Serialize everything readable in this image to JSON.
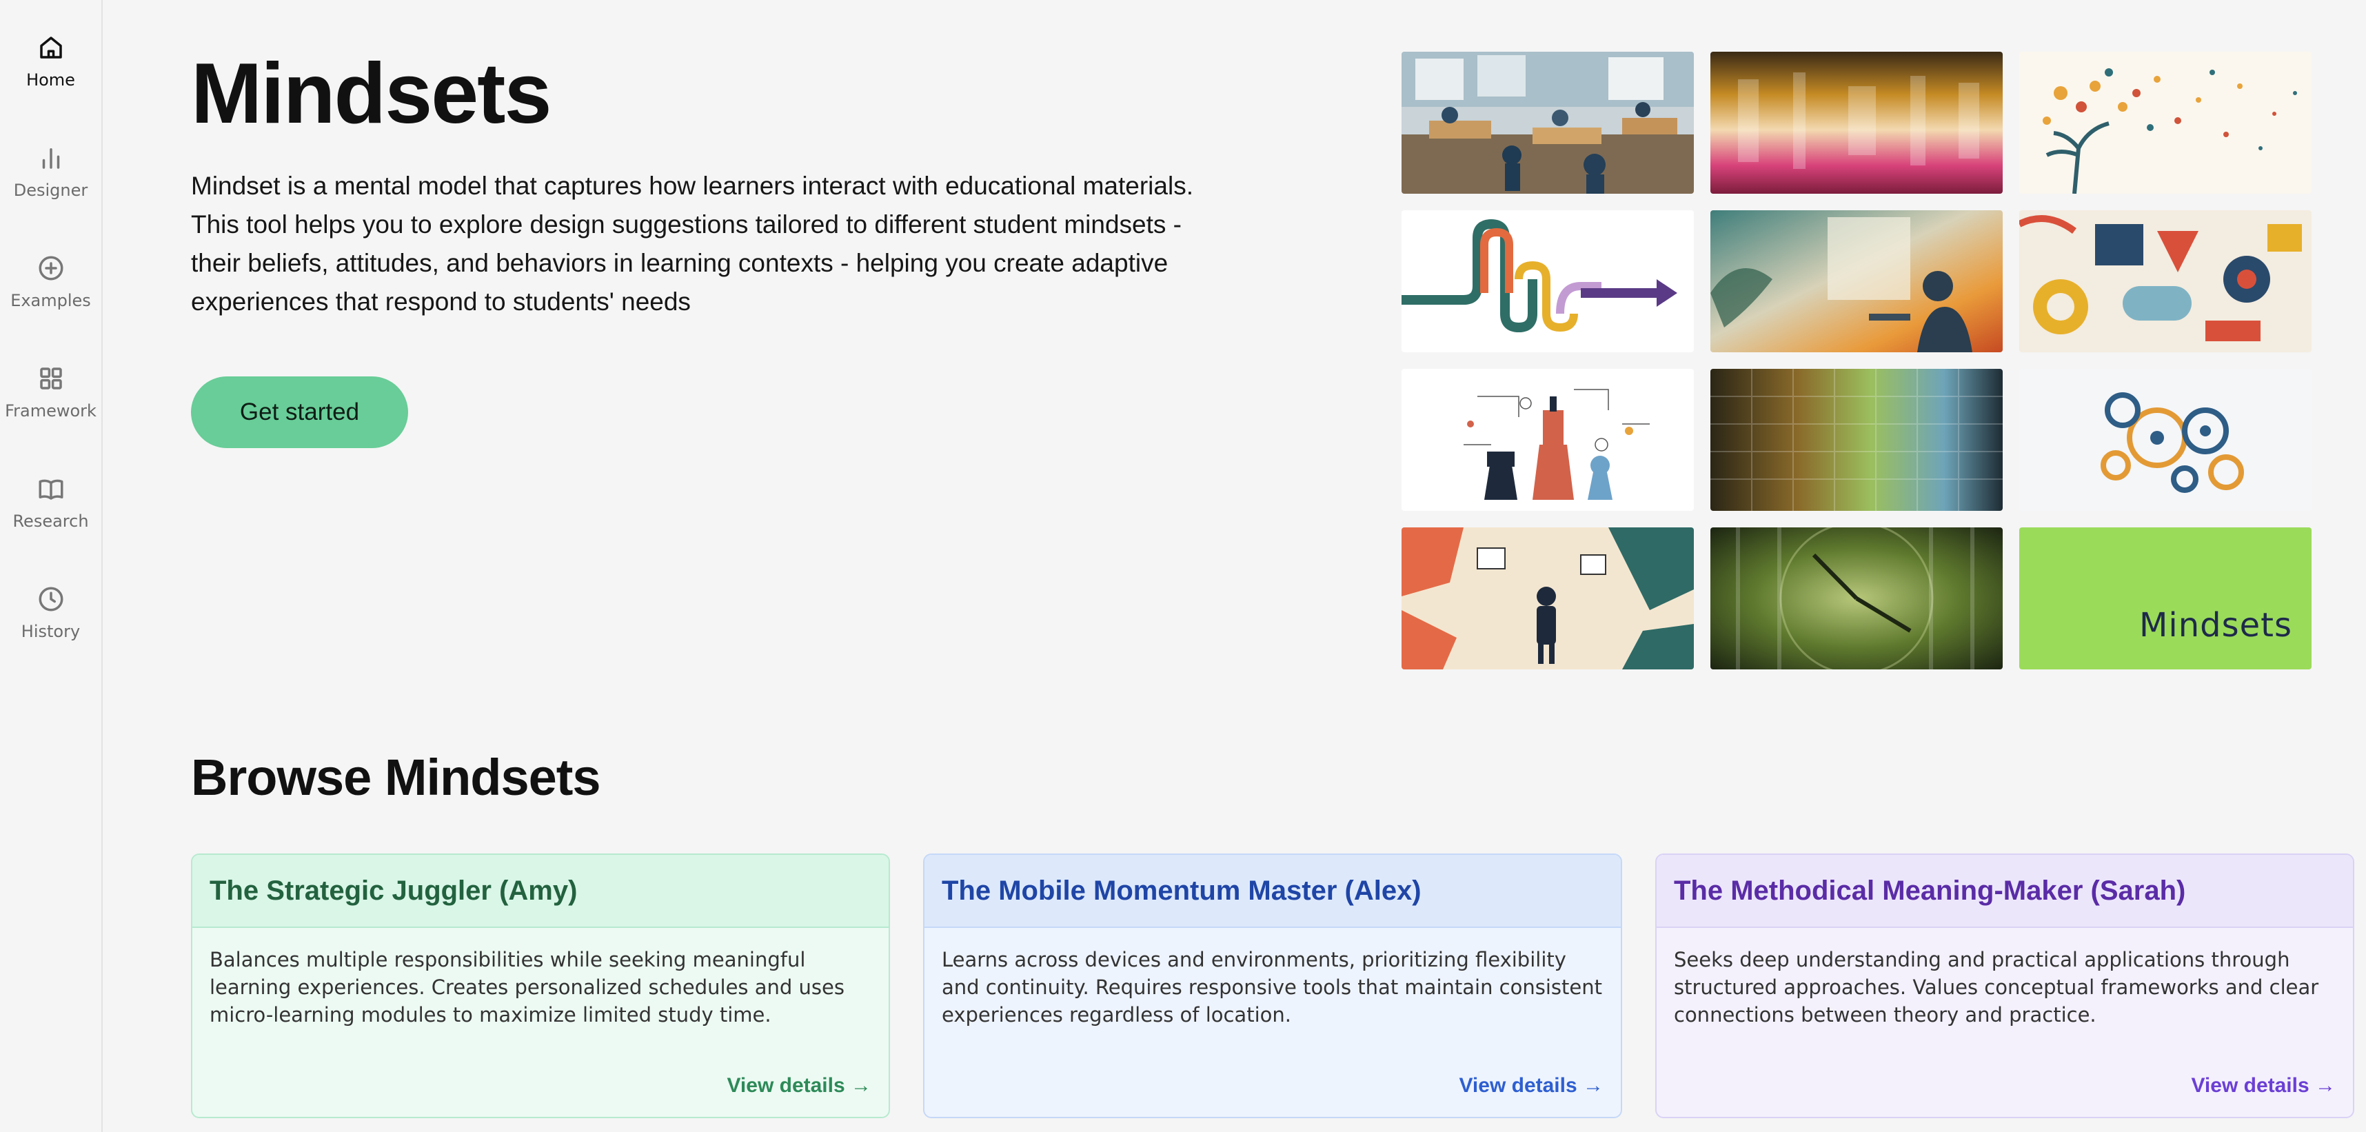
{
  "sidebar": {
    "items": [
      {
        "label": "Home",
        "icon": "home-icon",
        "active": true
      },
      {
        "label": "Designer",
        "icon": "bar-chart-icon",
        "active": false
      },
      {
        "label": "Examples",
        "icon": "plus-circle-icon",
        "active": false
      },
      {
        "label": "Framework",
        "icon": "grid-icon",
        "active": false
      },
      {
        "label": "Research",
        "icon": "book-icon",
        "active": false
      },
      {
        "label": "History",
        "icon": "clock-icon",
        "active": false
      }
    ]
  },
  "hero": {
    "title": "Mindsets",
    "description": "Mindset is a mental model that captures how learners interact with educational materials. This tool helps you to explore design suggestions tailored to different student mindsets - their beliefs, attitudes, and behaviors in learning contexts - helping you create adaptive experiences that respond to students' needs",
    "cta_label": "Get started",
    "accent": "#68cd98"
  },
  "gallery": {
    "tiles": [
      {
        "name": "classroom-watercolor-image"
      },
      {
        "name": "abstract-pink-gold-image"
      },
      {
        "name": "tree-dots-image"
      },
      {
        "name": "winding-arrows-image"
      },
      {
        "name": "person-at-window-image"
      },
      {
        "name": "geometric-shapes-image"
      },
      {
        "name": "chess-pieces-image"
      },
      {
        "name": "abstract-green-grid-image"
      },
      {
        "name": "gears-image"
      },
      {
        "name": "person-collage-image"
      },
      {
        "name": "abstract-clock-image"
      },
      {
        "name": "mindsets-logo-tile",
        "text": "Mindsets"
      }
    ]
  },
  "browse": {
    "title": "Browse Mindsets",
    "cards": [
      {
        "title": "The Strategic Juggler (Amy)",
        "description": "Balances multiple responsibilities while seeking meaningful learning experiences. Creates personalized schedules and uses micro-learning modules to maximize limited study time.",
        "link": "View details →"
      },
      {
        "title": "The Mobile Momentum Master (Alex)",
        "description": "Learns across devices and environments, prioritizing flexibility and continuity. Requires responsive tools that maintain consistent experiences regardless of location.",
        "link": "View details →"
      },
      {
        "title": "The Methodical Meaning-Maker (Sarah)",
        "description": "Seeks deep understanding and practical applications through structured approaches. Values conceptual frameworks and clear connections between theory and practice.",
        "link": "View details →"
      }
    ]
  }
}
